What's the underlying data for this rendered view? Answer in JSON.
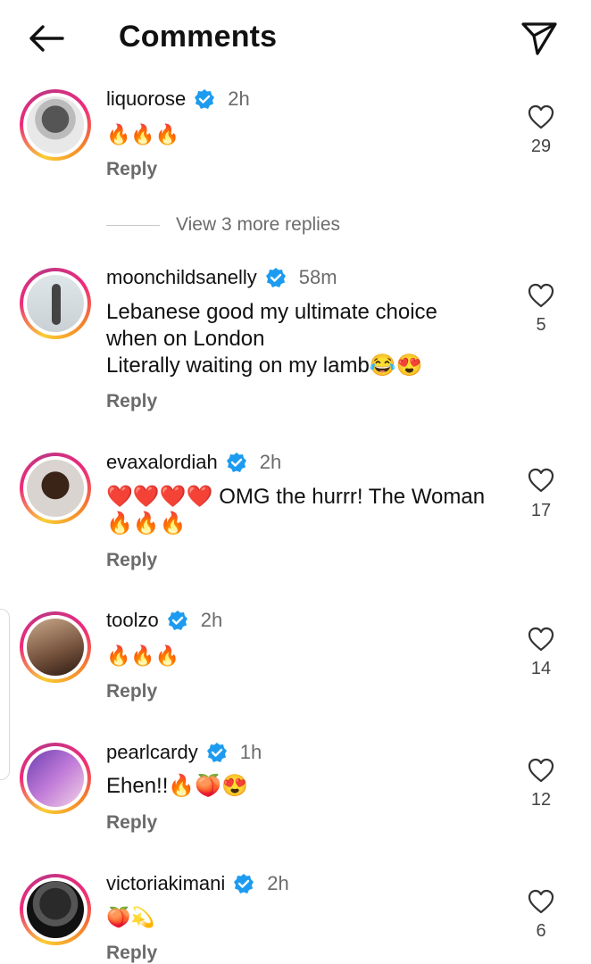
{
  "header": {
    "title": "Comments",
    "back_icon": "arrow-left-icon",
    "share_icon": "paper-plane-icon"
  },
  "colors": {
    "verified": "#1d9bf0",
    "ring_start": "#f9ce34",
    "ring_mid": "#ee2a7b",
    "ring_end": "#c13584",
    "muted": "#6b6b6b"
  },
  "reply_label": "Reply",
  "view_more": "View 3 more replies",
  "comments": [
    {
      "username": "liquorose",
      "time": "2h",
      "text": "🔥🔥🔥",
      "likes": "29"
    },
    {
      "username": "moonchildsanelly",
      "time": "58m",
      "text": "Lebanese good my ultimate choice\nwhen on London\nLiterally waiting on my lamb😂😍",
      "likes": "5"
    },
    {
      "username": "evaxalordiah",
      "time": "2h",
      "text": "❤️❤️❤️❤️ OMG the hurrr! The Woman\n🔥🔥🔥",
      "likes": "17"
    },
    {
      "username": "toolzo",
      "time": "2h",
      "text": "🔥🔥🔥",
      "likes": "14"
    },
    {
      "username": "pearlcardy",
      "time": "1h",
      "text": "Ehen!!🔥🍑😍",
      "likes": "12"
    },
    {
      "username": "victoriakimani",
      "time": "2h",
      "text": "🍑💫",
      "likes": "6"
    }
  ]
}
